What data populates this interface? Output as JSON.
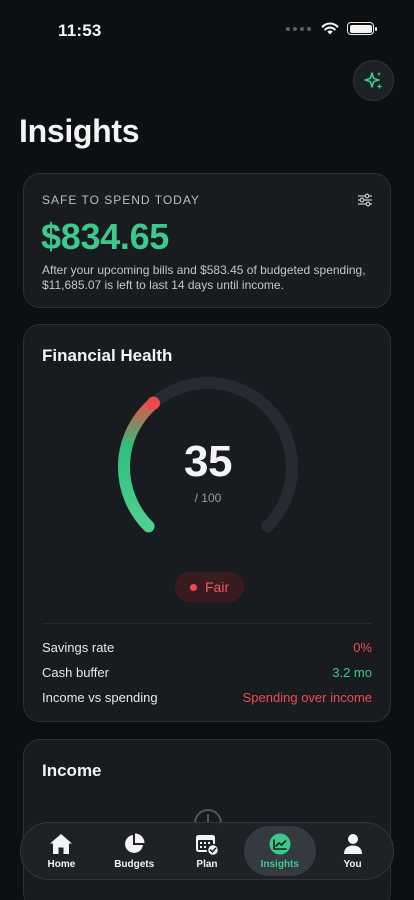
{
  "status_bar": {
    "time": "11:53"
  },
  "header": {
    "title": "Insights",
    "assistant_icon": "sparkle-icon"
  },
  "safe_to_spend": {
    "label": "SAFE TO SPEND TODAY",
    "amount": "$834.65",
    "description": "After your upcoming bills and $583.45 of budgeted spending, $11,685.07 is left to last 14 days until income.",
    "settings_icon": "sliders-icon"
  },
  "financial_health": {
    "title": "Financial Health",
    "score": "35",
    "max_label": "/ 100",
    "score_fraction": 0.35,
    "status": "Fair",
    "metrics": [
      {
        "label": "Savings rate",
        "value": "0%",
        "tone": "red"
      },
      {
        "label": "Cash buffer",
        "value": "3.2 mo",
        "tone": "green"
      },
      {
        "label": "Income vs spending",
        "value": "Spending over income",
        "tone": "red"
      }
    ]
  },
  "income": {
    "title": "Income",
    "empty_icon": "clock-icon"
  },
  "tabs": [
    {
      "label": "Home",
      "icon": "home-icon"
    },
    {
      "label": "Budgets",
      "icon": "pie-chart-icon"
    },
    {
      "label": "Plan",
      "icon": "calendar-check-icon"
    },
    {
      "label": "Insights",
      "icon": "trend-chart-icon",
      "active": true
    },
    {
      "label": "You",
      "icon": "person-icon"
    }
  ],
  "colors": {
    "accent": "#3ec98a",
    "danger": "#ef4b55",
    "background": "#0d1013",
    "card": "#181c20"
  }
}
